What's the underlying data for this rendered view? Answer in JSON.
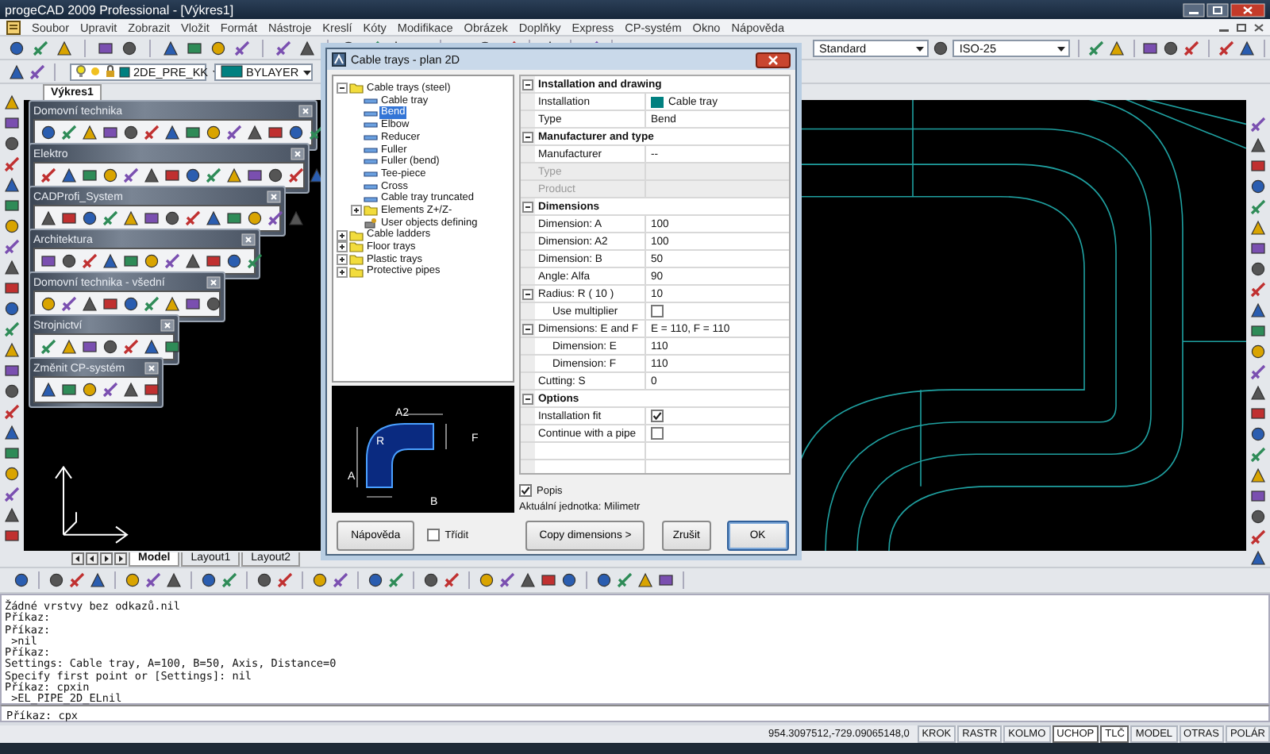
{
  "window": {
    "title": "progeCAD 2009 Professional - [Výkres1]"
  },
  "menu": [
    "Soubor",
    "Upravit",
    "Zobrazit",
    "Vložit",
    "Formát",
    "Nástroje",
    "Kreslí",
    "Kóty",
    "Modifikace",
    "Obrázek",
    "Doplňky",
    "Express",
    "CP-systém",
    "Okno",
    "Nápověda"
  ],
  "toolbar": {
    "text_style": "Standard",
    "dim_style": "ISO-25"
  },
  "layer_bar": {
    "layer": "2DE_PRE_KK",
    "color_setting": "BYLAYER"
  },
  "document_tab": {
    "label": "Výkres1"
  },
  "floating_toolbars": [
    {
      "title": "Domovní technika"
    },
    {
      "title": "Elektro"
    },
    {
      "title": "CADProfi_System"
    },
    {
      "title": "Architektura"
    },
    {
      "title": "Domovní technika - všední"
    },
    {
      "title": "Strojnictví"
    },
    {
      "title": "Změnit CP-systém"
    }
  ],
  "layout_tabs": [
    {
      "label": "Model",
      "selected": true
    },
    {
      "label": "Layout1",
      "selected": false
    },
    {
      "label": "Layout2",
      "selected": false
    }
  ],
  "dialog": {
    "title": "Cable trays - plan 2D",
    "tree": [
      {
        "label": "Cable trays (steel)",
        "kind": "folder",
        "selected": false,
        "expanded": true,
        "children": [
          {
            "label": "Cable tray",
            "kind": "part",
            "selected": false
          },
          {
            "label": "Bend",
            "kind": "part",
            "selected": true
          },
          {
            "label": "Elbow",
            "kind": "part",
            "selected": false
          },
          {
            "label": "Reducer",
            "kind": "part",
            "selected": false
          },
          {
            "label": "Fuller",
            "kind": "part",
            "selected": false
          },
          {
            "label": "Fuller (bend)",
            "kind": "part",
            "selected": false
          },
          {
            "label": "Tee-piece",
            "kind": "part",
            "selected": false
          },
          {
            "label": "Cross",
            "kind": "part",
            "selected": false
          },
          {
            "label": "Cable tray truncated",
            "kind": "part",
            "selected": false
          },
          {
            "label": "Elements Z+/Z-",
            "kind": "folder",
            "selected": false,
            "expanded": false
          },
          {
            "label": "User objects defining",
            "kind": "tool",
            "selected": false
          }
        ]
      },
      {
        "label": "Cable ladders",
        "kind": "folder",
        "selected": false,
        "expanded": false
      },
      {
        "label": "Floor trays",
        "kind": "folder",
        "selected": false,
        "expanded": false
      },
      {
        "label": "Plastic trays",
        "kind": "folder",
        "selected": false,
        "expanded": false
      },
      {
        "label": "Protective pipes",
        "kind": "folder",
        "selected": false,
        "expanded": false
      }
    ],
    "preview": {
      "labels": [
        "A2",
        "F",
        "R",
        "A",
        "B"
      ]
    },
    "properties": [
      {
        "title": "Installation and drawing",
        "expanded": true,
        "rows": [
          {
            "label": "Installation",
            "value": "Cable tray",
            "kind": "swatch",
            "color": "#008080",
            "disabled": false
          },
          {
            "label": "Type",
            "value": "Bend",
            "kind": "text",
            "disabled": false
          }
        ]
      },
      {
        "title": "Manufacturer and type",
        "expanded": true,
        "rows": [
          {
            "label": "Manufacturer",
            "value": "--",
            "kind": "text",
            "disabled": false
          },
          {
            "label": "Type",
            "kind": "text",
            "disabled": true
          },
          {
            "label": "Product",
            "kind": "text",
            "disabled": true
          }
        ]
      },
      {
        "title": "Dimensions",
        "expanded": true,
        "rows": [
          {
            "label": "Dimension: A",
            "value": "100",
            "kind": "text",
            "disabled": false
          },
          {
            "label": "Dimension: A2",
            "value": "100",
            "kind": "text",
            "disabled": false
          },
          {
            "label": "Dimension: B",
            "value": "50",
            "kind": "text",
            "disabled": false
          },
          {
            "label": "Angle: Alfa",
            "value": "90",
            "kind": "text",
            "disabled": false
          },
          {
            "label": "Radius: R  ( 10 )",
            "value": "10",
            "kind": "text",
            "disabled": false,
            "expanded": true,
            "children": [
              {
                "label": "Use multiplier",
                "kind": "check",
                "checked": false,
                "disabled": false
              }
            ]
          },
          {
            "label": "Dimensions: E and F",
            "value": "E = 110,  F = 110",
            "kind": "text",
            "disabled": false,
            "expanded": true,
            "children": [
              {
                "label": "Dimension: E",
                "value": "110",
                "kind": "text",
                "disabled": false
              },
              {
                "label": "Dimension: F",
                "value": "110",
                "kind": "text",
                "disabled": false
              }
            ]
          },
          {
            "label": "Cutting: S",
            "value": "0",
            "kind": "text",
            "disabled": false
          }
        ]
      },
      {
        "title": "Options",
        "expanded": true,
        "rows": [
          {
            "label": "Installation fit",
            "kind": "check",
            "checked": true,
            "disabled": false
          },
          {
            "label": "Continue with a pipe",
            "kind": "check",
            "checked": false,
            "disabled": false
          }
        ]
      }
    ],
    "popis": {
      "label": "Popis",
      "checked": true
    },
    "units": "Aktuální jednotka: Milimetr",
    "sort": {
      "label": "Třídit",
      "checked": false
    },
    "buttons": [
      {
        "label": "Nápověda",
        "default": false
      },
      {
        "label": "Copy dimensions  >",
        "default": false
      },
      {
        "label": "Zrušit",
        "default": false
      },
      {
        "label": "OK",
        "default": true
      }
    ]
  },
  "command_history": [
    "Žádné vrstvy bez odkazů.nil",
    "Příkaz:",
    "Příkaz:",
    " >nil",
    "Příkaz:",
    "Settings: Cable tray, A=100, B=50, Axis, Distance=0",
    "Specify first point or [Settings]: nil",
    "Příkaz: cpxin",
    " >EL_PIPE_2D_ELnil"
  ],
  "command_line": "Příkaz: cpx",
  "status_bar": {
    "coordinates": "954.3097512,-729.09065148,0",
    "toggles": [
      {
        "label": "KROK",
        "on": false
      },
      {
        "label": "RASTR",
        "on": false
      },
      {
        "label": "KOLMO",
        "on": false
      },
      {
        "label": "UCHOP",
        "on": true
      },
      {
        "label": "TLČ",
        "on": true
      },
      {
        "label": "MODEL",
        "on": false
      },
      {
        "label": "OTRAS",
        "on": false
      },
      {
        "label": "POLÁR",
        "on": false
      }
    ]
  }
}
